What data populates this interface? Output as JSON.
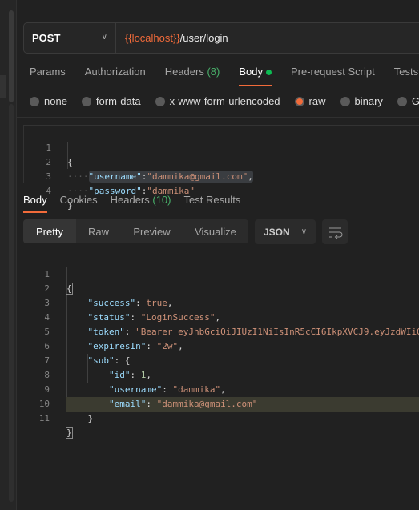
{
  "request": {
    "method": "POST",
    "url_variable": "{{localhost}}",
    "url_path": "/user/login"
  },
  "request_tabs": [
    {
      "label": "Params"
    },
    {
      "label": "Authorization"
    },
    {
      "label": "Headers",
      "count": "(8)"
    },
    {
      "label": "Body",
      "active": true
    },
    {
      "label": "Pre-request Script"
    },
    {
      "label": "Tests"
    }
  ],
  "body_types": [
    {
      "label": "none"
    },
    {
      "label": "form-data"
    },
    {
      "label": "x-www-form-urlencoded"
    },
    {
      "label": "raw",
      "selected": true
    },
    {
      "label": "binary"
    },
    {
      "label": "Gra"
    }
  ],
  "request_body": {
    "line_numbers": [
      "1",
      "2",
      "3",
      "4"
    ],
    "username_key": "\"username\"",
    "username_value": "\"dammika@gmail.com\"",
    "password_key": "\"password\"",
    "password_value": "\"dammika\""
  },
  "response_tabs": [
    {
      "label": "Body",
      "active": true
    },
    {
      "label": "Cookies"
    },
    {
      "label": "Headers",
      "count": "(10)"
    },
    {
      "label": "Test Results"
    }
  ],
  "view_modes": [
    {
      "label": "Pretty",
      "active": true
    },
    {
      "label": "Raw"
    },
    {
      "label": "Preview"
    },
    {
      "label": "Visualize"
    }
  ],
  "format": "JSON",
  "response_body": {
    "line_numbers": [
      "1",
      "2",
      "3",
      "4",
      "5",
      "6",
      "7",
      "8",
      "9",
      "10",
      "11"
    ],
    "success": "true",
    "status": "\"LoginSuccess\"",
    "token": "\"Bearer eyJhbGciOiJIUzI1NiIsInR5cCI6IkpXVCJ9.eyJzdWIiO",
    "expiresIn": "\"2w\"",
    "id": "1",
    "username": "\"dammika\"",
    "email": "\"dammika@gmail.com\""
  }
}
